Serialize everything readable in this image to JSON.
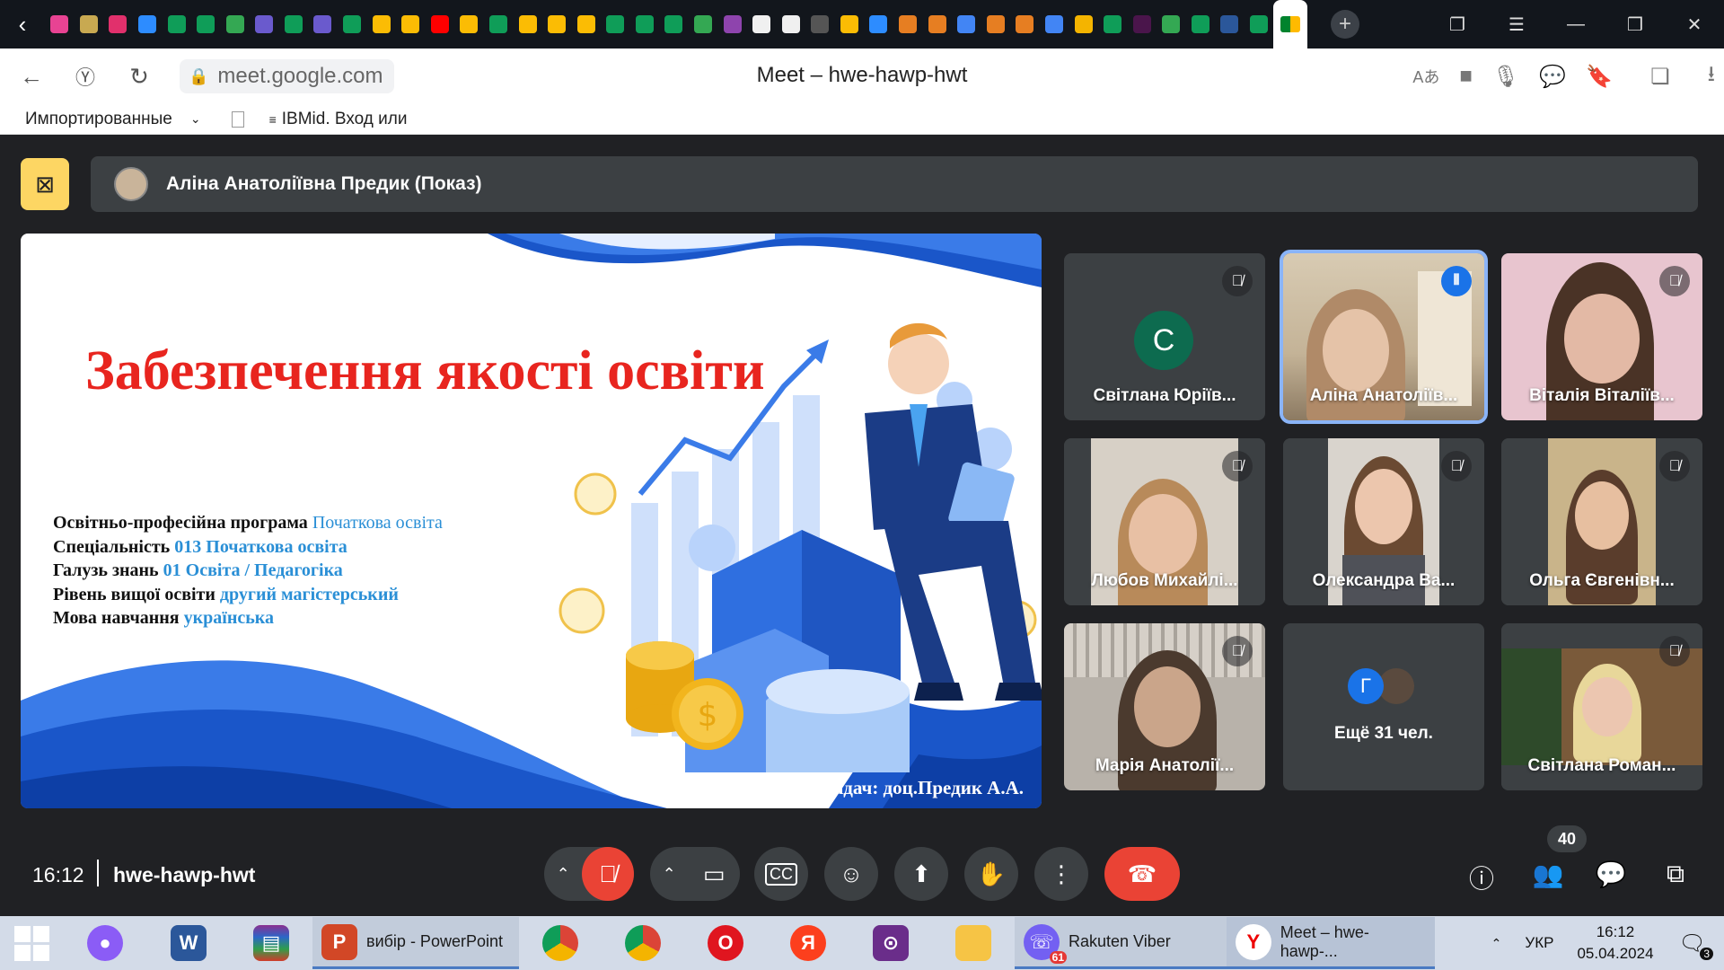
{
  "browser": {
    "url": "meet.google.com",
    "page_title": "Meet – hwe-hawp-hwt",
    "bookmarks": [
      "Импортированные",
      "IBMid. Вход или"
    ]
  },
  "presentation": {
    "presenter": "Аліна Анатоліївна Предик (Показ)",
    "slide": {
      "title": "Забезпечення якості освіти",
      "lines": [
        {
          "label": "Освітньо-професійна програма",
          "value": "Початкова освіта"
        },
        {
          "label": "Спеціальність",
          "value": "013 Початкова освіта"
        },
        {
          "label": "Галузь знань",
          "value": "01 Освіта / Педагогіка"
        },
        {
          "label": "Рівень вищої освіти",
          "value": "другий магістерський"
        },
        {
          "label": "Мова навчання",
          "value": "українська"
        }
      ],
      "teacher": "Викладач: доц.Предик А.А."
    }
  },
  "participants": [
    {
      "name": "Світлана Юріїв...",
      "letter": "С",
      "muted": true
    },
    {
      "name": "Аліна Анатоліїв...",
      "speaking": true
    },
    {
      "name": "Віталія Віталіїв...",
      "muted": true
    },
    {
      "name": "Любов Михайлі...",
      "muted": true
    },
    {
      "name": "Олександра Ва...",
      "muted": true
    },
    {
      "name": "Ольга Євгенівн...",
      "muted": true
    },
    {
      "name": "Марія Анатолії...",
      "muted": true
    },
    {
      "name": "Ещё 31 чел.",
      "letter": "Г"
    },
    {
      "name": "Світлана Роман...",
      "muted": true
    }
  ],
  "meeting": {
    "time": "16:12",
    "code": "hwe-hawp-hwt",
    "participant_count": "40"
  },
  "taskbar": {
    "apps": [
      "вибір - PowerPoint",
      "Rakuten Viber",
      "Meet – hwe-hawp-..."
    ],
    "viber_badge": "61",
    "language": "УКР",
    "time": "16:12",
    "date": "05.04.2024",
    "notifications": "3"
  },
  "colors": {
    "accent": "#1a73e8",
    "end_call": "#ea4335",
    "present": "#fdd663",
    "slide_title": "#e8251f",
    "slide_value": "#2a8fd6"
  }
}
